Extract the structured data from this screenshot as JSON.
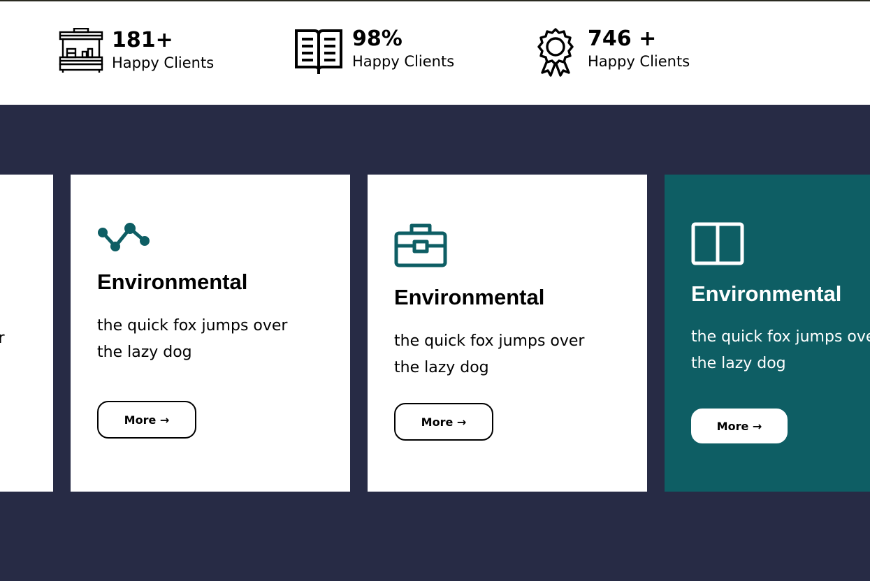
{
  "stats": [
    {
      "number": "181+",
      "label": "Happy Clients",
      "icon": "storefront-icon"
    },
    {
      "number": "98%",
      "label": "Happy Clients",
      "icon": "open-book-icon"
    },
    {
      "number": "746 +",
      "label": "Happy Clients",
      "icon": "award-badge-icon"
    }
  ],
  "cards": {
    "partial_fragment": "er",
    "items": [
      {
        "icon": "line-chart-icon",
        "title": "Environmental",
        "text_line1": "the quick fox jumps over",
        "text_line2": "the lazy dog",
        "button": "More →"
      },
      {
        "icon": "briefcase-icon",
        "title": "Environmental",
        "text_line1": "the quick fox jumps over",
        "text_line2": "the lazy dog",
        "button": "More →"
      },
      {
        "icon": "columns-icon",
        "title": "Environmental",
        "text_line1": "the quick fox jumps over",
        "text_line2": "the lazy dog",
        "button": "More →"
      }
    ]
  },
  "colors": {
    "band_background": "#272b45",
    "accent_teal": "#0e5e64",
    "card_background": "#ffffff"
  }
}
